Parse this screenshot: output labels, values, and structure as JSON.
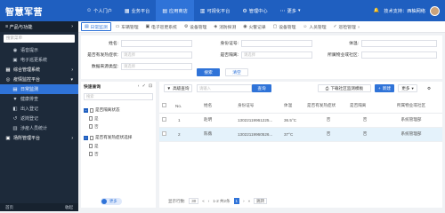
{
  "app": {
    "brand": "智慧军营"
  },
  "topnav": [
    {
      "label": "个人门户",
      "icon": "user-icon"
    },
    {
      "label": "业务平台",
      "icon": "grid-icon"
    },
    {
      "label": "应用商店",
      "icon": "store-icon",
      "active": true
    },
    {
      "label": "可视化平台",
      "icon": "chart-icon"
    },
    {
      "label": "管理中心",
      "icon": "gear-icon"
    },
    {
      "label": "更多",
      "icon": "more-icon"
    }
  ],
  "user": {
    "org": "技术支持：西柚网络"
  },
  "sidebar": {
    "header": "产品与功能",
    "search_placeholder": "搜索菜单",
    "items": [
      {
        "label": "语音提示",
        "type": "item"
      },
      {
        "label": "电子巡更系统",
        "type": "item"
      },
      {
        "label": "综合管理系统",
        "type": "group"
      },
      {
        "label": "疫情监控平台",
        "type": "group"
      },
      {
        "label": "日常监测",
        "type": "item",
        "active": true
      },
      {
        "label": "健康排查",
        "type": "item"
      },
      {
        "label": "出入登记",
        "type": "item"
      },
      {
        "label": "返岗登记",
        "type": "item"
      },
      {
        "label": "涉疫人员统计",
        "type": "item"
      },
      {
        "label": "场所管理平台",
        "type": "group"
      }
    ],
    "footer": {
      "home": "首页",
      "collapse": "收起"
    }
  },
  "tabs": [
    {
      "label": "日常监测",
      "active": true
    },
    {
      "label": "车辆管理"
    },
    {
      "label": "电子巡更系统"
    },
    {
      "label": "设备管理"
    },
    {
      "label": "消防探测"
    },
    {
      "label": "火警记录"
    },
    {
      "label": "设备管理"
    },
    {
      "label": "人员管理"
    },
    {
      "label": "巡检管理"
    }
  ],
  "filters": {
    "name": {
      "label": "姓名:",
      "placeholder": ""
    },
    "id_card": {
      "label": "身份证号:",
      "placeholder": ""
    },
    "temperature": {
      "label": "体温:",
      "placeholder": ""
    },
    "symptom": {
      "label": "是否有发热症状:",
      "placeholder": "请选择"
    },
    "contact": {
      "label": "是否隔离:",
      "placeholder": "请选择"
    },
    "community": {
      "label": "所属物业或社区:",
      "placeholder": ""
    },
    "source": {
      "label": "数据来源类型:",
      "placeholder": "请选择"
    },
    "search_btn": "搜索",
    "reset_btn": "清空"
  },
  "quick": {
    "title": "快速查询",
    "search_placeholder": "搜索",
    "groups": [
      {
        "label": "是否隔离状态",
        "options": [
          "是",
          "否"
        ]
      },
      {
        "label": "是否有发热症状选择",
        "options": [
          "是",
          "否"
        ]
      }
    ],
    "toggle_label": "更多"
  },
  "table": {
    "filter_btn": "高级查询",
    "search_placeholder": "请输入",
    "query_btn": "查询",
    "import_btn": "下载社区监测模板",
    "new_btn": "新建",
    "more_btn": "更多",
    "columns": [
      "No.",
      "姓名",
      "身份证号",
      "体温",
      "是否有发热症状",
      "是否隔离",
      "所属物业或社区"
    ],
    "rows": [
      [
        "1",
        "赵明",
        "13022119961225...",
        "36.5°C",
        "否",
        "否",
        "系统管理部"
      ],
      [
        "2",
        "陈薇",
        "13022119960526...",
        "37°C",
        "否",
        "否",
        "系统管理部"
      ]
    ],
    "pager": {
      "prefix": "显示行数:",
      "rows": "30",
      "range": "1-2 共2条",
      "page": "1",
      "goto": "跳转"
    }
  }
}
